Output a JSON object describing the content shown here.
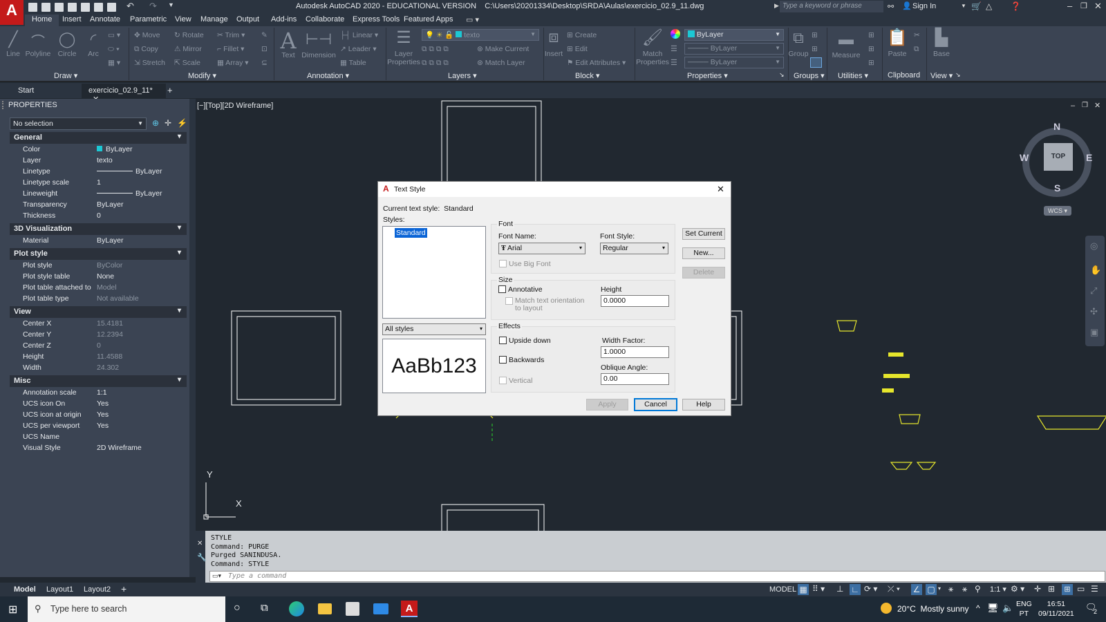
{
  "titlebar": {
    "title": "Autodesk AutoCAD 2020 - EDUCATIONAL VERSION",
    "path": "C:\\Users\\20201334\\Desktop\\SRDA\\Aulas\\exercicio_02.9_11.dwg",
    "search_placeholder": "Type a keyword or phrase",
    "sign_in": "Sign In"
  },
  "ribbon_tabs": [
    "Home",
    "Insert",
    "Annotate",
    "Parametric",
    "View",
    "Manage",
    "Output",
    "Add-ins",
    "Collaborate",
    "Express Tools",
    "Featured Apps"
  ],
  "ribbon": {
    "draw": {
      "label": "Draw",
      "tools": [
        "Line",
        "Polyline",
        "Circle",
        "Arc"
      ]
    },
    "modify": {
      "label": "Modify",
      "tools": [
        "Move",
        "Rotate",
        "Trim",
        "Copy",
        "Mirror",
        "Fillet",
        "Stretch",
        "Scale",
        "Array"
      ]
    },
    "annotation": {
      "label": "Annotation",
      "tools": [
        "Text",
        "Dimension",
        "Linear",
        "Leader",
        "Table"
      ]
    },
    "layers": {
      "label": "Layers",
      "layer_properties": "Layer Properties",
      "current_layer": "texto",
      "tools": [
        "Make Current",
        "Match Layer"
      ]
    },
    "block": {
      "label": "Block",
      "insert": "Insert",
      "tools": [
        "Create",
        "Edit",
        "Edit Attributes"
      ]
    },
    "properties": {
      "label": "Properties",
      "match": "Match Properties",
      "color": "ByLayer",
      "linetype": "ByLayer",
      "lineweight": "ByLayer"
    },
    "groups": {
      "label": "Groups",
      "group": "Group"
    },
    "utilities": {
      "label": "Utilities",
      "measure": "Measure"
    },
    "clipboard": {
      "label": "Clipboard",
      "paste": "Paste"
    },
    "view": {
      "label": "View",
      "base": "Base"
    }
  },
  "doc_tabs": {
    "start": "Start",
    "current": "exercicio_02.9_11*"
  },
  "properties_panel": {
    "title": "PROPERTIES",
    "selection": "No selection",
    "sections": [
      {
        "name": "General",
        "rows": [
          {
            "k": "Color",
            "v": "ByLayer"
          },
          {
            "k": "Layer",
            "v": "texto"
          },
          {
            "k": "Linetype",
            "v": "ByLayer"
          },
          {
            "k": "Linetype scale",
            "v": "1"
          },
          {
            "k": "Lineweight",
            "v": "ByLayer"
          },
          {
            "k": "Transparency",
            "v": "ByLayer"
          },
          {
            "k": "Thickness",
            "v": "0"
          }
        ]
      },
      {
        "name": "3D Visualization",
        "rows": [
          {
            "k": "Material",
            "v": "ByLayer"
          }
        ]
      },
      {
        "name": "Plot style",
        "rows": [
          {
            "k": "Plot style",
            "v": "ByColor"
          },
          {
            "k": "Plot style table",
            "v": "None"
          },
          {
            "k": "Plot table attached to",
            "v": "Model"
          },
          {
            "k": "Plot table type",
            "v": "Not available"
          }
        ]
      },
      {
        "name": "View",
        "rows": [
          {
            "k": "Center X",
            "v": "15.4181"
          },
          {
            "k": "Center Y",
            "v": "12.2394"
          },
          {
            "k": "Center Z",
            "v": "0"
          },
          {
            "k": "Height",
            "v": "11.4588"
          },
          {
            "k": "Width",
            "v": "24.302"
          }
        ]
      },
      {
        "name": "Misc",
        "rows": [
          {
            "k": "Annotation scale",
            "v": "1:1"
          },
          {
            "k": "UCS icon On",
            "v": "Yes"
          },
          {
            "k": "UCS icon at origin",
            "v": "Yes"
          },
          {
            "k": "UCS per viewport",
            "v": "Yes"
          },
          {
            "k": "UCS Name",
            "v": ""
          },
          {
            "k": "Visual Style",
            "v": "2D Wireframe"
          }
        ]
      }
    ]
  },
  "viewport": {
    "label": "[−][Top][2D Wireframe]",
    "compass": {
      "n": "N",
      "s": "S",
      "e": "E",
      "w": "W",
      "top": "TOP",
      "wcs": "WCS"
    },
    "ucs_x": "X",
    "ucs_y": "Y"
  },
  "dialog": {
    "title": "Text Style",
    "current_label": "Current text style:",
    "current_value": "Standard",
    "styles_label": "Styles:",
    "styles": [
      "Standard"
    ],
    "filter": "All styles",
    "preview": "AaBb123",
    "font_group": "Font",
    "font_name_label": "Font Name:",
    "font_name": "Arial",
    "font_style_label": "Font Style:",
    "font_style": "Regular",
    "use_big_font": "Use Big Font",
    "size_group": "Size",
    "annotative": "Annotative",
    "match_orientation": "Match text orientation",
    "match_orientation_2": "to layout",
    "height_label": "Height",
    "height": "0.0000",
    "effects_group": "Effects",
    "upside_down": "Upside down",
    "backwards": "Backwards",
    "vertical": "Vertical",
    "width_factor_label": "Width Factor:",
    "width_factor": "1.0000",
    "oblique_label": "Oblique Angle:",
    "oblique": "0.00",
    "set_current": "Set Current",
    "new": "New...",
    "delete": "Delete",
    "apply": "Apply",
    "cancel": "Cancel",
    "help": "Help"
  },
  "command": {
    "history": [
      "STYLE",
      "Command: PURGE",
      "Purged SANINDUSA.",
      "Command: STYLE"
    ],
    "placeholder": "Type a command"
  },
  "layout_tabs": [
    "Model",
    "Layout1",
    "Layout2"
  ],
  "statusbar": {
    "model": "MODEL",
    "scale": "1:1"
  },
  "taskbar": {
    "search": "Type here to search",
    "weather": "20°C  Mostly sunny",
    "lang": "ENG",
    "lang2": "PT",
    "time": "16:51",
    "date": "09/11/2021",
    "notif": "2"
  },
  "colors": {
    "accent": "#1f6fd6",
    "yellow_geom": "#e6e62c",
    "autocad_red": "#c41a1a"
  }
}
